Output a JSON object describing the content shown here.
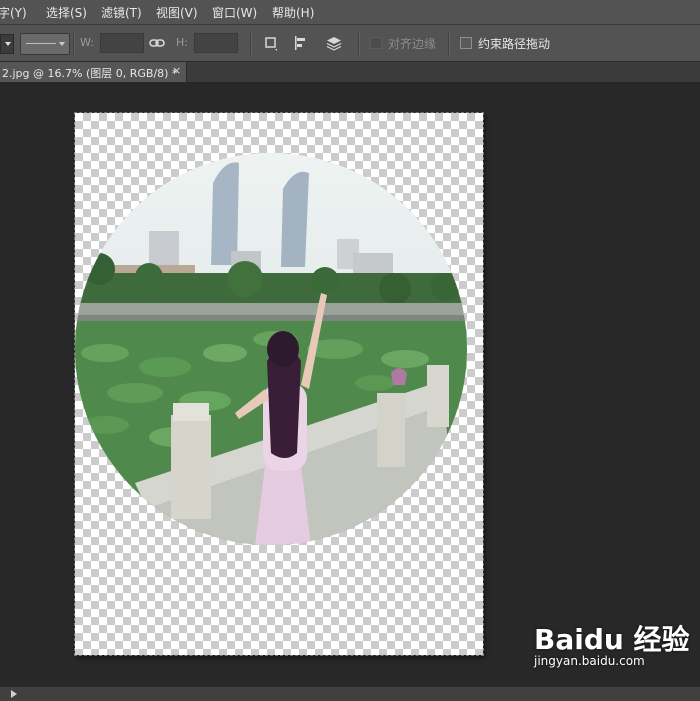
{
  "menu": [
    {
      "label": "字(Y)",
      "key": "type"
    },
    {
      "label": "选择(S)",
      "key": "select"
    },
    {
      "label": "滤镜(T)",
      "key": "filter"
    },
    {
      "label": "视图(V)",
      "key": "view"
    },
    {
      "label": "窗口(W)",
      "key": "window"
    },
    {
      "label": "帮助(H)",
      "key": "help"
    }
  ],
  "options_bar": {
    "w_label": "W:",
    "w_value": "",
    "h_label": "H:",
    "h_value": "",
    "align_edges_label": "对齐边缘",
    "align_edges_checked": false,
    "align_edges_enabled": false,
    "constrain_path_label": "约束路径拖动",
    "constrain_path_checked": false
  },
  "document_tab": {
    "title": "2.jpg @ 16.7% (图层 0, RGB/8) *",
    "close": "×"
  },
  "watermark": {
    "logo": "Baidu 经验",
    "site": "jingyan.baidu.com"
  },
  "colors": {
    "menubar": "#535353",
    "workspace": "#282828",
    "checker_light": "#ffffff",
    "checker_dark": "#cccccc"
  }
}
